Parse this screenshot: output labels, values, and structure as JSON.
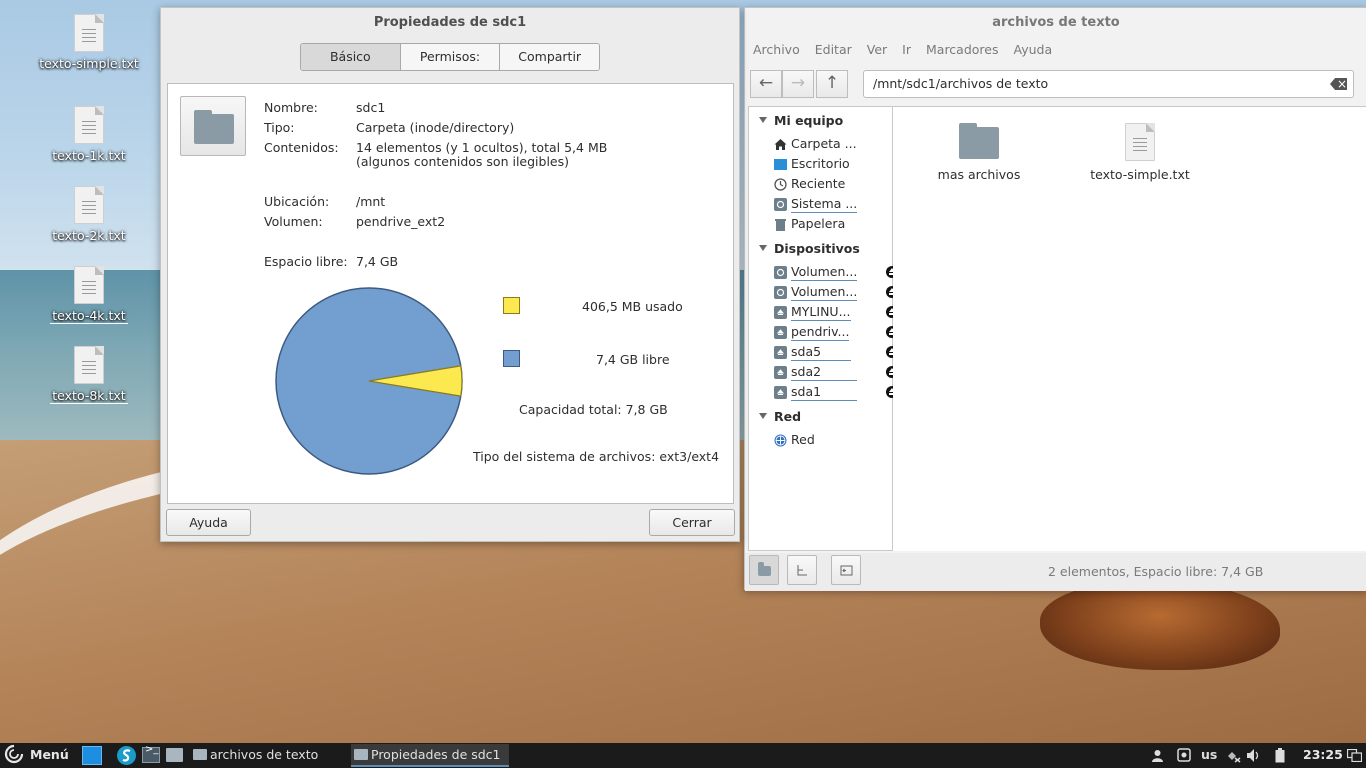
{
  "desktop": {
    "icons": [
      {
        "label": "texto-simple.txt"
      },
      {
        "label": "texto-1k.txt"
      },
      {
        "label": "texto-2k.txt"
      },
      {
        "label": "texto-4k.txt"
      },
      {
        "label": "texto-8k.txt"
      }
    ]
  },
  "props_dialog": {
    "title": "Propiedades de sdc1",
    "tabs": [
      "Básico",
      "Permisos:",
      "Compartir"
    ],
    "active_tab": 0,
    "fields": {
      "name_key": "Nombre:",
      "name_val": "sdc1",
      "type_key": "Tipo:",
      "type_val": "Carpeta (inode/directory)",
      "contents_key": "Contenidos:",
      "contents_val": "14 elementos (y 1 ocultos), total 5,4 MB",
      "contents_val2": "(algunos contenidos son ilegibles)",
      "location_key": "Ubicación:",
      "location_val": "/mnt",
      "volume_key": "Volumen:",
      "volume_val": "pendrive_ext2",
      "free_key": "Espacio libre:",
      "free_val": "7,4 GB"
    },
    "legend": {
      "used": "406,5 MB usado",
      "free": "7,4 GB libre",
      "total": "Capacidad total: 7,8 GB",
      "fstype": "Tipo del sistema de archivos: ext3/ext4"
    },
    "colors": {
      "used": "#fce94f",
      "free": "#729fcf",
      "used_stroke": "#8a7a1e",
      "free_stroke": "#3d5a80"
    },
    "used_fraction": 0.052,
    "help_label": "Ayuda",
    "close_label": "Cerrar"
  },
  "file_manager": {
    "title": "archivos de texto",
    "menu": [
      "Archivo",
      "Editar",
      "Ver",
      "Ir",
      "Marcadores",
      "Ayuda"
    ],
    "path": "/mnt/sdc1/archivos de texto",
    "sections": {
      "my_pc": "Mi equipo",
      "devices": "Dispositivos",
      "network": "Red"
    },
    "my_pc_items": [
      {
        "label": "Carpeta ..."
      },
      {
        "label": "Escritorio"
      },
      {
        "label": "Reciente"
      },
      {
        "label": "Sistema ..."
      },
      {
        "label": "Papelera"
      }
    ],
    "device_items": [
      {
        "label": "Volumen..."
      },
      {
        "label": "Volumen..."
      },
      {
        "label": "MYLINU..."
      },
      {
        "label": "pendriv..."
      },
      {
        "label": "sda5"
      },
      {
        "label": "sda2"
      },
      {
        "label": "sda1"
      }
    ],
    "network_items": [
      {
        "label": "Red"
      }
    ],
    "items": [
      {
        "label": "mas archivos"
      },
      {
        "label": "texto-simple.txt"
      }
    ],
    "status": "2 elementos, Espacio libre: 7,4 GB"
  },
  "taskbar": {
    "menu_label": "Menú",
    "tasks": [
      {
        "label": "archivos de texto"
      },
      {
        "label": "Propiedades de sdc1"
      }
    ],
    "keyboard": "us",
    "clock": "23:25"
  }
}
